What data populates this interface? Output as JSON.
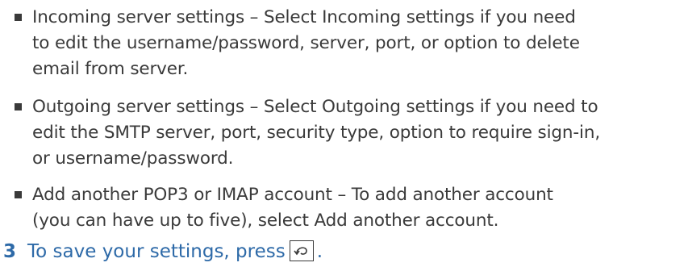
{
  "bullets": [
    {
      "text": "Incoming server settings – Select Incoming settings if you need\nto edit the username/password, server, port, or option to delete\nemail from server."
    },
    {
      "text": "Outgoing server settings – Select Outgoing settings if you need to\nedit the SMTP server, port, security type, option to require sign-in,\nor username/password."
    },
    {
      "text": "Add another POP3 or IMAP account – To add another account\n(you can have up to five), select Add another account."
    }
  ],
  "step": {
    "number": "3",
    "text": "To save your settings, press",
    "icon": "back-key-icon",
    "end": "."
  },
  "colors": {
    "body_text": "#3a3a3a",
    "step_text": "#2e6aa8"
  }
}
